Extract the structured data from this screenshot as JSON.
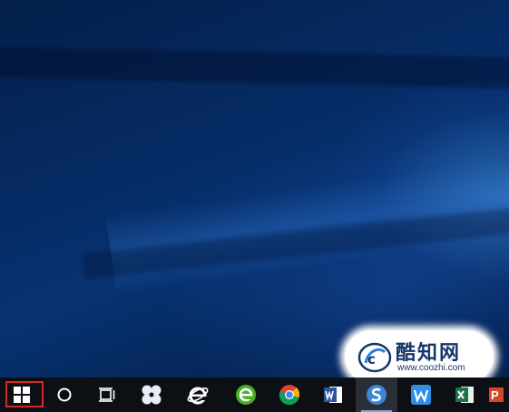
{
  "desktop": {
    "wallpaper": "windows-10-hero-blue"
  },
  "watermark": {
    "brand": "酷知网",
    "url": "www.coozhi.com"
  },
  "taskbar": {
    "items": [
      {
        "name": "start-button",
        "icon": "windows-logo-icon",
        "highlighted": true
      },
      {
        "name": "cortana-search-button",
        "icon": "circle-icon"
      },
      {
        "name": "task-view-button",
        "icon": "task-view-icon"
      },
      {
        "name": "fan-app-taskbar-button",
        "icon": "fan-icon"
      },
      {
        "name": "internet-explorer-taskbar-button",
        "icon": "internet-explorer-icon"
      },
      {
        "name": "green-browser-taskbar-button",
        "icon": "green-e-browser-icon"
      },
      {
        "name": "chrome-taskbar-button",
        "icon": "chrome-icon"
      },
      {
        "name": "word-taskbar-button",
        "icon": "word-icon"
      },
      {
        "name": "sogou-browser-taskbar-button",
        "icon": "sogou-browser-icon",
        "active": true
      },
      {
        "name": "wps-writer-taskbar-button",
        "icon": "wps-writer-icon"
      },
      {
        "name": "excel-taskbar-button",
        "icon": "excel-icon"
      },
      {
        "name": "powerpoint-taskbar-button",
        "icon": "powerpoint-icon"
      }
    ],
    "highlight_color": "#d62828",
    "background": "#0c0f13"
  }
}
